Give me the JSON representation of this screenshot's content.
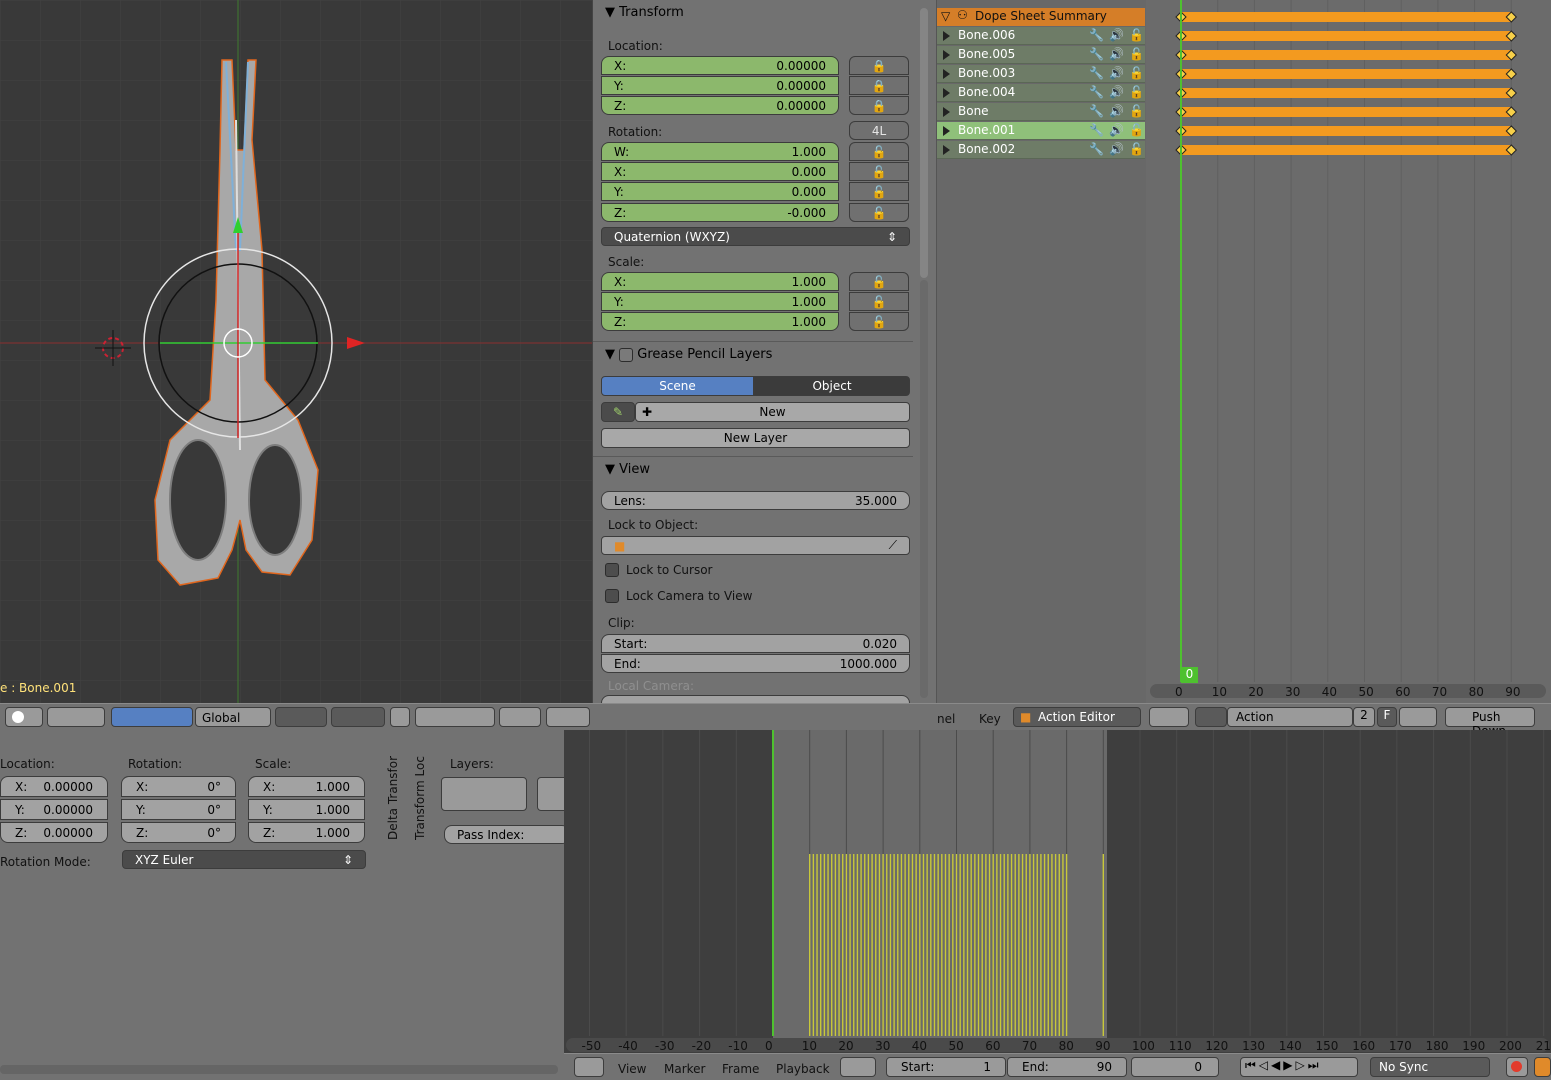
{
  "viewport": {
    "active_label": "e : Bone.001",
    "header": {
      "orientation_label": "Global"
    }
  },
  "props": {
    "transform": {
      "title": "Transform",
      "location_label": "Location:",
      "location": [
        {
          "axis": "X:",
          "value": "0.00000"
        },
        {
          "axis": "Y:",
          "value": "0.00000"
        },
        {
          "axis": "Z:",
          "value": "0.00000"
        }
      ],
      "rotation_label": "Rotation:",
      "rotation_lock_label": "4L",
      "rotation": [
        {
          "axis": "W:",
          "value": "1.000"
        },
        {
          "axis": "X:",
          "value": "0.000"
        },
        {
          "axis": "Y:",
          "value": "0.000"
        },
        {
          "axis": "Z:",
          "value": "-0.000"
        }
      ],
      "rotation_mode": "Quaternion (WXYZ)",
      "scale_label": "Scale:",
      "scale": [
        {
          "axis": "X:",
          "value": "1.000"
        },
        {
          "axis": "Y:",
          "value": "1.000"
        },
        {
          "axis": "Z:",
          "value": "1.000"
        }
      ]
    },
    "grease": {
      "title": "Grease Pencil Layers",
      "tab_scene": "Scene",
      "tab_object": "Object",
      "new_label": "New",
      "new_layer_label": "New Layer"
    },
    "view": {
      "title": "View",
      "lens_label": "Lens:",
      "lens_value": "35.000",
      "lock_object_label": "Lock to Object:",
      "lock_cursor_label": "Lock to Cursor",
      "lock_camera_label": "Lock Camera to View",
      "clip_label": "Clip:",
      "clip_start_label": "Start:",
      "clip_start_value": "0.020",
      "clip_end_label": "End:",
      "clip_end_value": "1000.000",
      "local_camera_label": "Local Camera:"
    }
  },
  "dope": {
    "summary": "Dope Sheet Summary",
    "channels": [
      "Bone.006",
      "Bone.005",
      "Bone.003",
      "Bone.004",
      "Bone",
      "Bone.001",
      "Bone.002"
    ],
    "selected_channel": "Bone.001",
    "current_frame": "0",
    "ruler": [
      "0",
      "10",
      "20",
      "30",
      "40",
      "50",
      "60",
      "70",
      "80",
      "90"
    ],
    "header": {
      "channel_menu": "nel",
      "key_menu": "Key",
      "mode": "Action Editor",
      "action_label": "Action",
      "users": "2",
      "fake_user": "F",
      "push_down": "Push Down"
    }
  },
  "bottom_props": {
    "location_label": "Location:",
    "rotation_label": "Rotation:",
    "scale_label": "Scale:",
    "location": [
      {
        "axis": "X:",
        "value": "0.00000"
      },
      {
        "axis": "Y:",
        "value": "0.00000"
      },
      {
        "axis": "Z:",
        "value": "0.00000"
      }
    ],
    "rotation": [
      {
        "axis": "X:",
        "value": "0°"
      },
      {
        "axis": "Y:",
        "value": "0°"
      },
      {
        "axis": "Z:",
        "value": "0°"
      }
    ],
    "scale": [
      {
        "axis": "X:",
        "value": "1.000"
      },
      {
        "axis": "Y:",
        "value": "1.000"
      },
      {
        "axis": "Z:",
        "value": "1.000"
      }
    ],
    "rotation_mode_label": "Rotation Mode:",
    "rotation_mode": "XYZ Euler",
    "tab_delta": "Delta Transfor",
    "tab_locks": "Transform Loc",
    "layers_label": "Layers:",
    "pass_index_label": "Pass Index:"
  },
  "timeline": {
    "ruler": [
      "-50",
      "-40",
      "-30",
      "-20",
      "-10",
      "0",
      "10",
      "20",
      "30",
      "40",
      "50",
      "60",
      "70",
      "80",
      "90",
      "100",
      "110",
      "120",
      "130",
      "140",
      "150",
      "160",
      "170",
      "180",
      "190",
      "200",
      "21"
    ],
    "menus": [
      "View",
      "Marker",
      "Frame",
      "Playback"
    ],
    "start_label": "Start:",
    "start_value": "1",
    "end_label": "End:",
    "end_value": "90",
    "current_value": "0",
    "sync": "No Sync"
  },
  "colors": {
    "accent_blue": "#5680c2",
    "field_green": "#8cb86c",
    "summary_orange": "#d57e28",
    "key_orange": "#f39a1f",
    "playhead_green": "#4ec12f"
  }
}
